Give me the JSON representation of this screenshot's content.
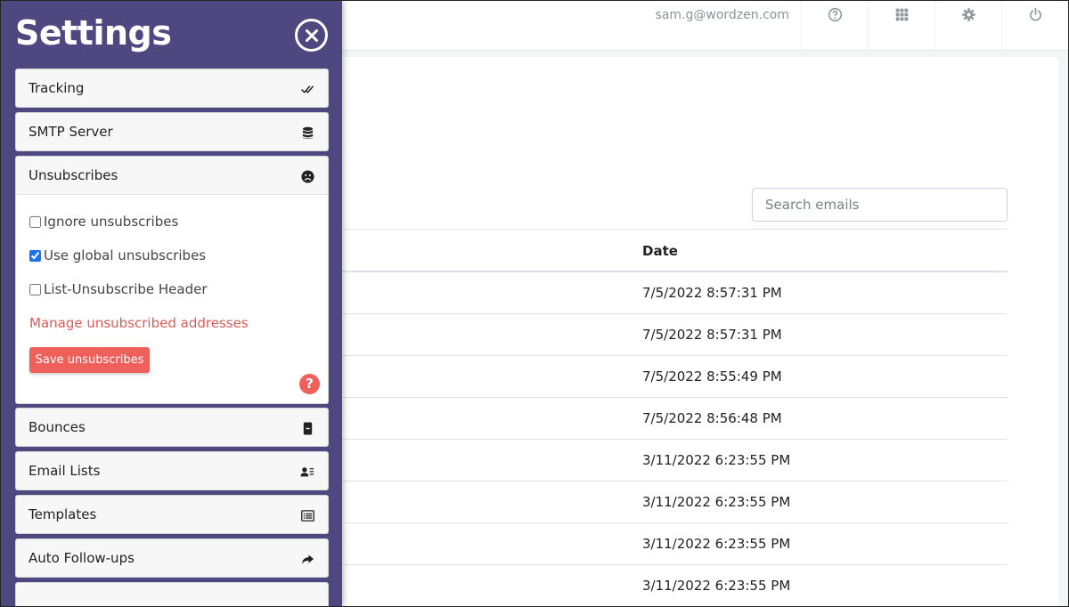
{
  "header": {
    "user_email": "sam.g@wordzen.com",
    "icons": [
      "help-circle-icon",
      "apps-grid-icon",
      "gear-icon",
      "power-icon"
    ]
  },
  "search": {
    "placeholder": "Search emails",
    "value": ""
  },
  "table": {
    "columns": [
      "Date"
    ],
    "rows": [
      {
        "date": "7/5/2022 8:57:31 PM"
      },
      {
        "date": "7/5/2022 8:57:31 PM"
      },
      {
        "date": "7/5/2022 8:55:49 PM"
      },
      {
        "date": "7/5/2022 8:56:48 PM"
      },
      {
        "date": "3/11/2022 6:23:55 PM"
      },
      {
        "date": "3/11/2022 6:23:55 PM"
      },
      {
        "date": "3/11/2022 6:23:55 PM"
      },
      {
        "date": "3/11/2022 6:23:55 PM"
      }
    ]
  },
  "settings": {
    "title": "Settings",
    "sections": [
      {
        "label": "Tracking",
        "icon": "double-check-icon"
      },
      {
        "label": "SMTP Server",
        "icon": "database-icon"
      },
      {
        "label": "Unsubscribes",
        "icon": "sad-face-icon",
        "expanded": true
      },
      {
        "label": "Bounces",
        "icon": "mobile-device-icon"
      },
      {
        "label": "Email Lists",
        "icon": "contact-list-icon"
      },
      {
        "label": "Templates",
        "icon": "list-alt-icon"
      },
      {
        "label": "Auto Follow-ups",
        "icon": "reply-all-icon"
      }
    ],
    "unsubscribes": {
      "options": [
        {
          "label": "Ignore unsubscribes",
          "checked": false
        },
        {
          "label": "Use global unsubscribes",
          "checked": true
        },
        {
          "label": "List-Unsubscribe Header",
          "checked": false
        }
      ],
      "manage_link": "Manage unsubscribed addresses",
      "save_label": "Save unsubscribes",
      "help_label": "?"
    }
  },
  "colors": {
    "panel_bg": "#4e4780",
    "accent_red": "#f0605b",
    "link_red": "#e05a56",
    "checkbox_blue": "#1a73e8"
  }
}
